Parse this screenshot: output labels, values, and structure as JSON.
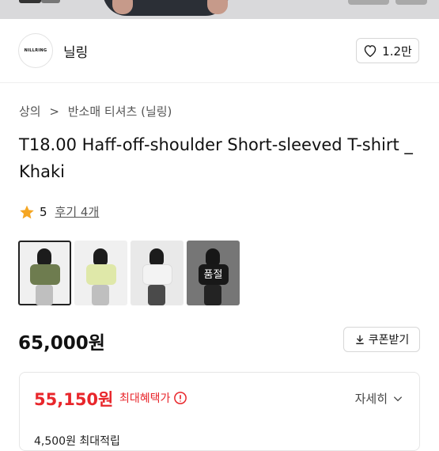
{
  "shop": {
    "logo_text": "NILLRING",
    "name": "닐링",
    "favorite_count": "1.2만"
  },
  "breadcrumb": {
    "category": "상의",
    "separator": ">",
    "subcategory": "반소매 티셔츠 (닐링)"
  },
  "product": {
    "title": "T18.00 Haff-off-shoulder Short-sleeved T-shirt _ Khaki",
    "rating": "5",
    "reviews_label": "후기 4개",
    "thumbnails": [
      {
        "color": "khaki",
        "selected": true
      },
      {
        "color": "light-yellow",
        "selected": false
      },
      {
        "color": "white",
        "selected": false
      },
      {
        "color": "black",
        "selected": false,
        "badge": "품절"
      }
    ],
    "price": "65,000원",
    "coupon_label": "쿠폰받기"
  },
  "benefit": {
    "max_price": "55,150원",
    "max_label": "최대혜택가",
    "detail_label": "자세히",
    "sub_text": "4,500원 최대적립"
  },
  "colors": {
    "accent_red": "#e8262b",
    "star": "#f5a623"
  }
}
